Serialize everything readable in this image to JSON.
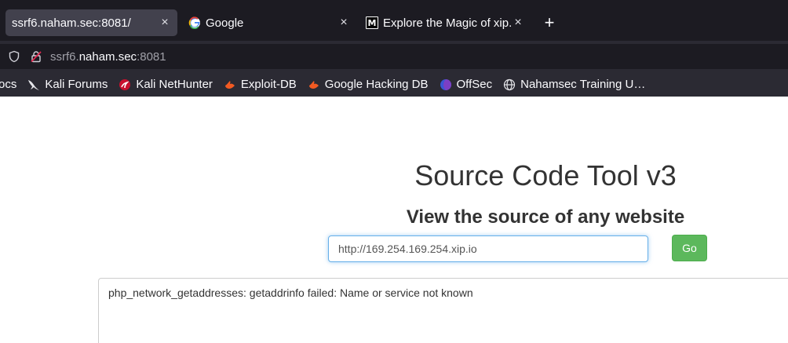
{
  "tabs": [
    {
      "title": "ssrf6.naham.sec:8081/",
      "active": true,
      "favicon": "none",
      "close": "×"
    },
    {
      "title": "Google",
      "active": false,
      "favicon": "google-icon",
      "close": "×"
    },
    {
      "title": "Explore the Magic of xip.io",
      "active": false,
      "favicon": "medium-icon",
      "close": "×"
    }
  ],
  "new_tab": "+",
  "address": {
    "prefix": "ssrf6.",
    "host": "naham.sec",
    "suffix": ":8081"
  },
  "bookmarks": [
    {
      "label": "ocs",
      "icon": "none"
    },
    {
      "label": "Kali Forums",
      "icon": "kali-dragon-icon"
    },
    {
      "label": "Kali NetHunter",
      "icon": "nethunter-icon"
    },
    {
      "label": "Exploit-DB",
      "icon": "exploit-db-icon"
    },
    {
      "label": "Google Hacking DB",
      "icon": "exploit-db-icon"
    },
    {
      "label": "OffSec",
      "icon": "offsec-icon"
    },
    {
      "label": "Nahamsec Training U…",
      "icon": "globe-icon"
    }
  ],
  "page": {
    "title": "Source Code Tool v3",
    "subtitle": "View the source of any website",
    "url_value": "http://169.254.169.254.xip.io",
    "go_label": "Go",
    "result_text": "php_network_getaddresses: getaddrinfo failed: Name or service not known"
  },
  "colors": {
    "go_button": "#5cb85c",
    "input_focus": "#66afe9",
    "chrome_dark": "#1c1b22",
    "chrome_mid": "#2b2a33"
  }
}
